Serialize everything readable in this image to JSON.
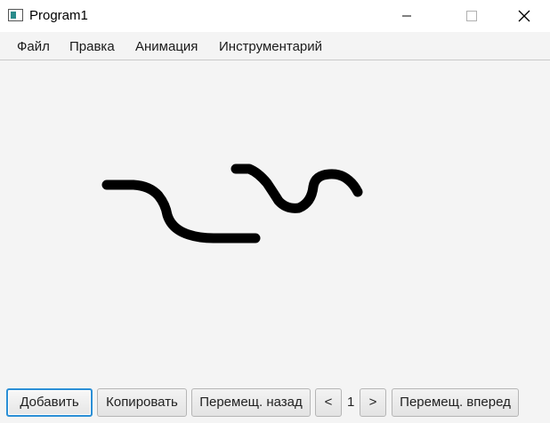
{
  "window": {
    "title": "Program1",
    "app_icon": "window-app-icon",
    "controls": [
      "minimize-icon",
      "maximize-icon",
      "close-icon"
    ]
  },
  "menu": {
    "items": [
      "Файл",
      "Правка",
      "Анимация",
      "Инструментарий"
    ]
  },
  "canvas": {
    "background": "#f4f4f4",
    "stroke_color": "#000000",
    "strokes": [
      "hand-drawn-curve-left",
      "hand-drawn-curve-right"
    ]
  },
  "toolbar": {
    "add_label": "Добавить",
    "copy_label": "Копировать",
    "move_back_label": "Перемещ. назад",
    "prev_label": "<",
    "page_number": "1",
    "next_label": ">",
    "move_forward_label": "Перемещ. вперед"
  },
  "colors": {
    "focus_border": "#2b8fd6",
    "menubar_bg": "#f4f4f4"
  }
}
